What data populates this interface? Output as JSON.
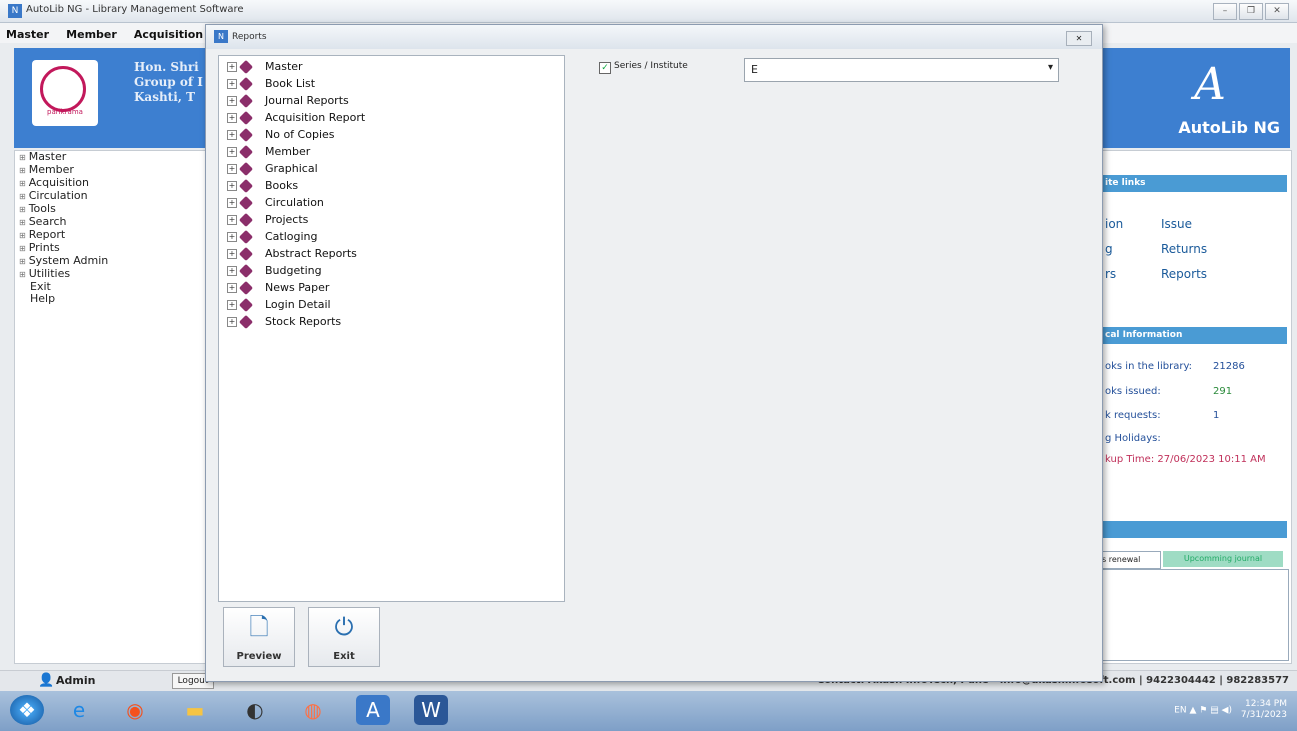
{
  "app": {
    "title": "AutoLib NG - Library Management Software"
  },
  "menubar": [
    "Master",
    "Member",
    "Acquisition"
  ],
  "banner": {
    "line1": "Hon. Shri",
    "line2": "Group of I",
    "line3": "Kashti, T",
    "brand": "AutoLib NG",
    "logo_text": "parikrama"
  },
  "left_nav": [
    {
      "label": "Master",
      "expandable": true
    },
    {
      "label": "Member",
      "expandable": true
    },
    {
      "label": "Acquisition",
      "expandable": true
    },
    {
      "label": "Circulation",
      "expandable": true
    },
    {
      "label": "Tools",
      "expandable": true
    },
    {
      "label": "Search",
      "expandable": true
    },
    {
      "label": "Report",
      "expandable": true
    },
    {
      "label": "Prints",
      "expandable": true
    },
    {
      "label": "System Admin",
      "expandable": true
    },
    {
      "label": "Utilities",
      "expandable": true
    },
    {
      "label": "Exit",
      "expandable": false
    },
    {
      "label": "Help",
      "expandable": false
    }
  ],
  "right_panel": {
    "quick_links_title": "ite links",
    "quick_links": [
      "ion",
      "Issue",
      "g",
      "Returns",
      "rs",
      "Reports"
    ],
    "stats_title": "cal Information",
    "stats": [
      {
        "label": "oks in the library:",
        "value": "21286"
      },
      {
        "label": "oks issued:",
        "value": "291"
      },
      {
        "label": "k requests:",
        "value": "1"
      },
      {
        "label": "g Holidays:",
        "value": ""
      },
      {
        "label": "kup Time: 27/06/2023 10:11 AM",
        "value": ""
      }
    ],
    "tab_renewal": "s renewal",
    "tab_journal": "Upcomming journal"
  },
  "status_bar": {
    "user": "Admin",
    "logout": "Logout",
    "contact": "Contact: Akash InfoTech, Pune - info@akashinfosoft.com | 9422304442 | 982283577"
  },
  "taskbar": {
    "tray_lang": "EN",
    "time": "12:34 PM",
    "date": "7/31/2023"
  },
  "dialog": {
    "title": "Reports",
    "tree": [
      "Master",
      "Book List",
      "Journal Reports",
      "Acquisition Report",
      "No of Copies",
      "Member",
      "Graphical",
      "Books",
      "Circulation",
      "Projects",
      "Catloging",
      "Abstract Reports",
      "Budgeting",
      "News Paper",
      "Login Detail",
      "Stock Reports"
    ],
    "checkbox_label": "Series / Institute",
    "checkbox_checked": true,
    "select_value": "E",
    "preview_label": "Preview",
    "exit_label": "Exit"
  }
}
